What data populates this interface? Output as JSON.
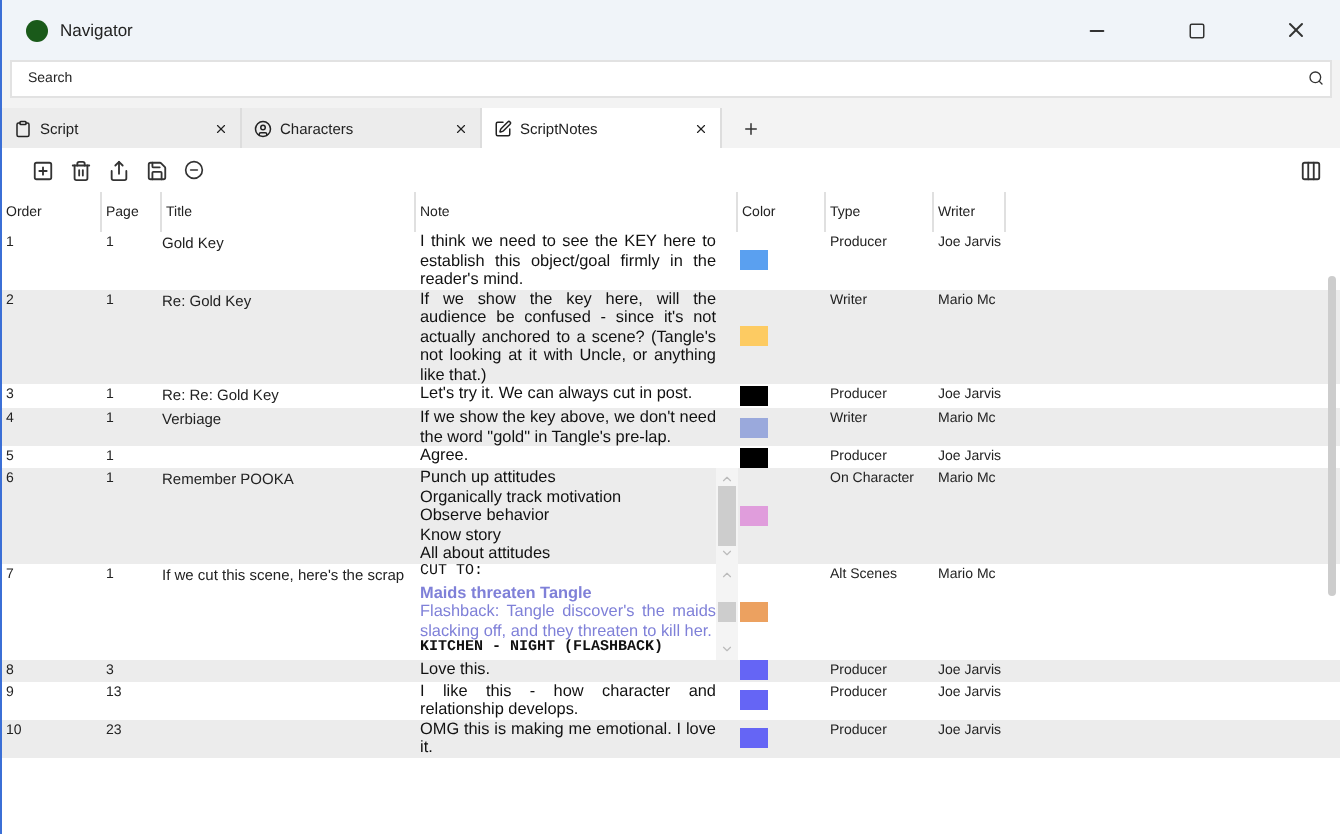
{
  "window": {
    "title": "Navigator"
  },
  "search": {
    "placeholder": "Search"
  },
  "tabs": [
    {
      "label": "Script",
      "kind": "script",
      "selected": false
    },
    {
      "label": "Characters",
      "kind": "characters",
      "selected": false
    },
    {
      "label": "ScriptNotes",
      "kind": "notes",
      "selected": true
    }
  ],
  "table": {
    "columns": [
      "Order",
      "Page",
      "Title",
      "Note",
      "Color",
      "Type",
      "Writer"
    ],
    "rows": [
      {
        "order": "1",
        "page": "1",
        "title": "Gold Key",
        "note": [
          {
            "kind": "plain",
            "text": "I think we need to see the KEY here to establish this object/goal firmly in the reader's mind."
          }
        ],
        "color": "#5aa0f0",
        "type": "Producer",
        "writer": "Joe Jarvis"
      },
      {
        "order": "2",
        "page": "1",
        "title": "Re: Gold Key",
        "note": [
          {
            "kind": "plain",
            "text": "If we show the key here, will the audience be confused - since it's not actually anchored to a scene? (Tangle's not looking at it with Uncle, or anything like that.)"
          }
        ],
        "color": "#fdcb62",
        "type": "Writer",
        "writer": "Mario Mc"
      },
      {
        "order": "3",
        "page": "1",
        "title": "Re: Re: Gold Key",
        "note": [
          {
            "kind": "plain",
            "text": "Let's try it.  We can always cut in post."
          }
        ],
        "color": "#000000",
        "type": "Producer",
        "writer": "Joe Jarvis"
      },
      {
        "order": "4",
        "page": "1",
        "title": "Verbiage",
        "note": [
          {
            "kind": "plain",
            "text": "If we show the key above, we don't need the word \"gold\" in Tangle's pre-lap."
          }
        ],
        "color": "#9aa9dc",
        "type": "Writer",
        "writer": "Mario Mc"
      },
      {
        "order": "5",
        "page": "1",
        "title": "",
        "note": [
          {
            "kind": "plain",
            "text": "Agree."
          }
        ],
        "color": "#000000",
        "type": "Producer",
        "writer": "Joe Jarvis"
      },
      {
        "order": "6",
        "page": "1",
        "title": "Remember POOKA",
        "note": [
          {
            "kind": "line",
            "text": "Punch up attitudes"
          },
          {
            "kind": "line",
            "text": "Organically track motivation"
          },
          {
            "kind": "line",
            "text": "Observe behavior"
          },
          {
            "kind": "line",
            "text": "Know story"
          },
          {
            "kind": "line",
            "text": "All about attitudes"
          }
        ],
        "color": "#e09ddc",
        "type": "On Character",
        "writer": "Mario Mc"
      },
      {
        "order": "7",
        "page": "1",
        "title": "If we cut this scene, here's the scrap",
        "note": [
          {
            "kind": "transition",
            "text": "CUT TO:"
          },
          {
            "kind": "heading",
            "text": "Maids threaten Tangle"
          },
          {
            "kind": "action",
            "text": "Flashback: Tangle discover's the maids slacking off, and they threaten to kill her."
          },
          {
            "kind": "scene",
            "text": "KITCHEN - NIGHT (FLASHBACK)"
          }
        ],
        "color": "#eca160",
        "type": "Alt Scenes",
        "writer": "Mario Mc"
      },
      {
        "order": "8",
        "page": "3",
        "title": "",
        "note": [
          {
            "kind": "plain",
            "text": "Love this."
          }
        ],
        "color": "#6565f5",
        "type": "Producer",
        "writer": "Joe Jarvis"
      },
      {
        "order": "9",
        "page": "13",
        "title": "",
        "note": [
          {
            "kind": "plain",
            "text": "I like this - how character and relationship develops."
          }
        ],
        "color": "#6565f5",
        "type": "Producer",
        "writer": "Joe Jarvis"
      },
      {
        "order": "10",
        "page": "23",
        "title": "",
        "note": [
          {
            "kind": "plain",
            "text": "OMG this is making me emotional. I love it."
          }
        ],
        "color": "#6565f5",
        "type": "Producer",
        "writer": "Joe Jarvis"
      }
    ]
  }
}
